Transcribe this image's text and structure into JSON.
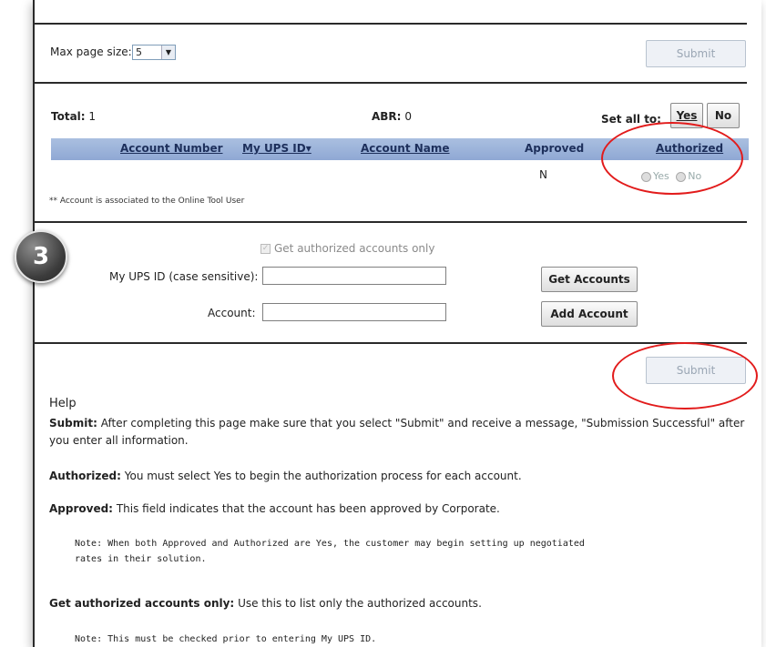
{
  "top": {
    "max_page_size_label": "Max page size:",
    "max_page_size_value": "5",
    "submit_label": "Submit"
  },
  "summary": {
    "total_label": "Total:",
    "total_value": "1",
    "abr_label": "ABR:",
    "abr_value": "0",
    "set_all_label": "Set all to:",
    "yes_label": "Yes",
    "no_label": "No"
  },
  "table": {
    "columns": [
      "Account Number",
      "My UPS ID",
      "Account Name",
      "Approved",
      "Authorized"
    ],
    "sort_indicator": "▾",
    "row": {
      "approved": "N",
      "yes_label": "Yes",
      "no_label": "No"
    },
    "footnote": "** Account is associated to the Online Tool User"
  },
  "form": {
    "step_number": "3",
    "authorized_only_label": "Get authorized accounts only",
    "ups_id_label": "My UPS ID (case sensitive):",
    "ups_id_value": "",
    "account_label": "Account:",
    "account_value": "",
    "get_accounts_label": "Get Accounts",
    "add_account_label": "Add Account"
  },
  "bottom": {
    "submit_label": "Submit"
  },
  "help": {
    "title": "Help",
    "submit_term": "Submit:",
    "submit_text": "After completing this page make sure that you select \"Submit\" and receive a message, \"Submission Successful\" after you enter all information.",
    "authorized_term": "Authorized:",
    "authorized_text": "You must select Yes to begin the authorization process for each account.",
    "approved_term": "Approved:",
    "approved_text": "This field indicates that the account has been approved by Corporate.",
    "note1_line1": "Note: When both Approved and Authorized are Yes, the customer may begin setting up negotiated",
    "note1_line2": "rates in their solution.",
    "authorized_only_term": "Get authorized accounts only:",
    "authorized_only_text": "Use this to list only the authorized accounts.",
    "note2": "Note: This must be checked prior to entering My UPS ID."
  },
  "colors": {
    "annotation_red": "#e21b1b",
    "header_blue": "#9bb3dc"
  }
}
